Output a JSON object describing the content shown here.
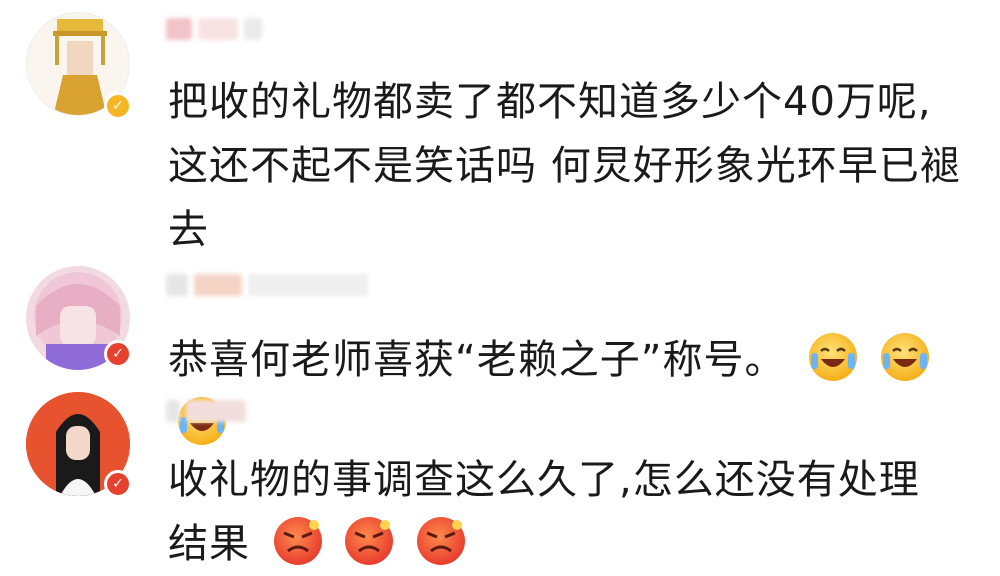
{
  "comments": [
    {
      "text_lines": [
        "把收的礼物都卖了都不知道多少个40万呢,",
        "这还不起不是笑话吗 何炅好形象光环早已褪",
        "去"
      ],
      "badge": "✓",
      "badge_color": "#f5b623"
    },
    {
      "text": "恭喜何老师喜获“老赖之子”称号。",
      "emojis": [
        "laugh-cry-emoji",
        "laugh-cry-emoji",
        "laugh-cry-emoji"
      ],
      "badge": "✓",
      "badge_color": "#e8402f"
    },
    {
      "text_lines": [
        "收礼物的事调查这么久了,怎么还没有处理",
        "结果"
      ],
      "emojis": [
        "angry-emoji",
        "angry-emoji",
        "angry-emoji"
      ],
      "badge": "✓",
      "badge_color": "#e8402f"
    }
  ]
}
